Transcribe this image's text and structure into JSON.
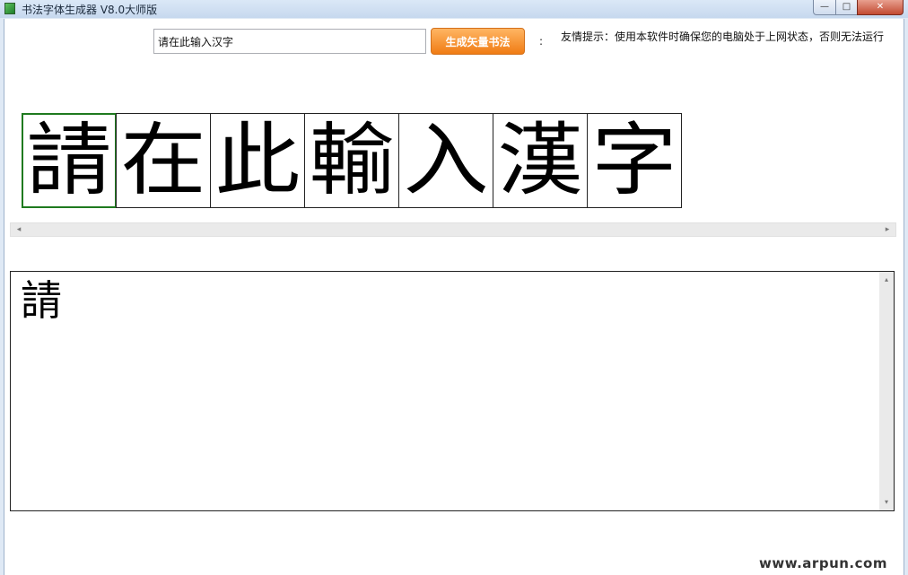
{
  "window": {
    "title": "书法字体生成器 V8.0大师版",
    "min_glyph": "—",
    "max_glyph": "□",
    "close_glyph": "✕"
  },
  "toolbar": {
    "input_value": "请在此输入汉字",
    "generate_label": "生成矢量书法",
    "colon": ":",
    "tip": "友情提示：使用本软件时确保您的电脑处于上网状态，否则无法运行"
  },
  "glyphs": [
    "請",
    "在",
    "此",
    "輸",
    "入",
    "漢",
    "字"
  ],
  "selected_glyph_index": 0,
  "preview": {
    "char": "請"
  },
  "scroll": {
    "left": "◂",
    "right": "▸",
    "up": "▴",
    "down": "▾"
  },
  "watermark": "www.arpun.com"
}
